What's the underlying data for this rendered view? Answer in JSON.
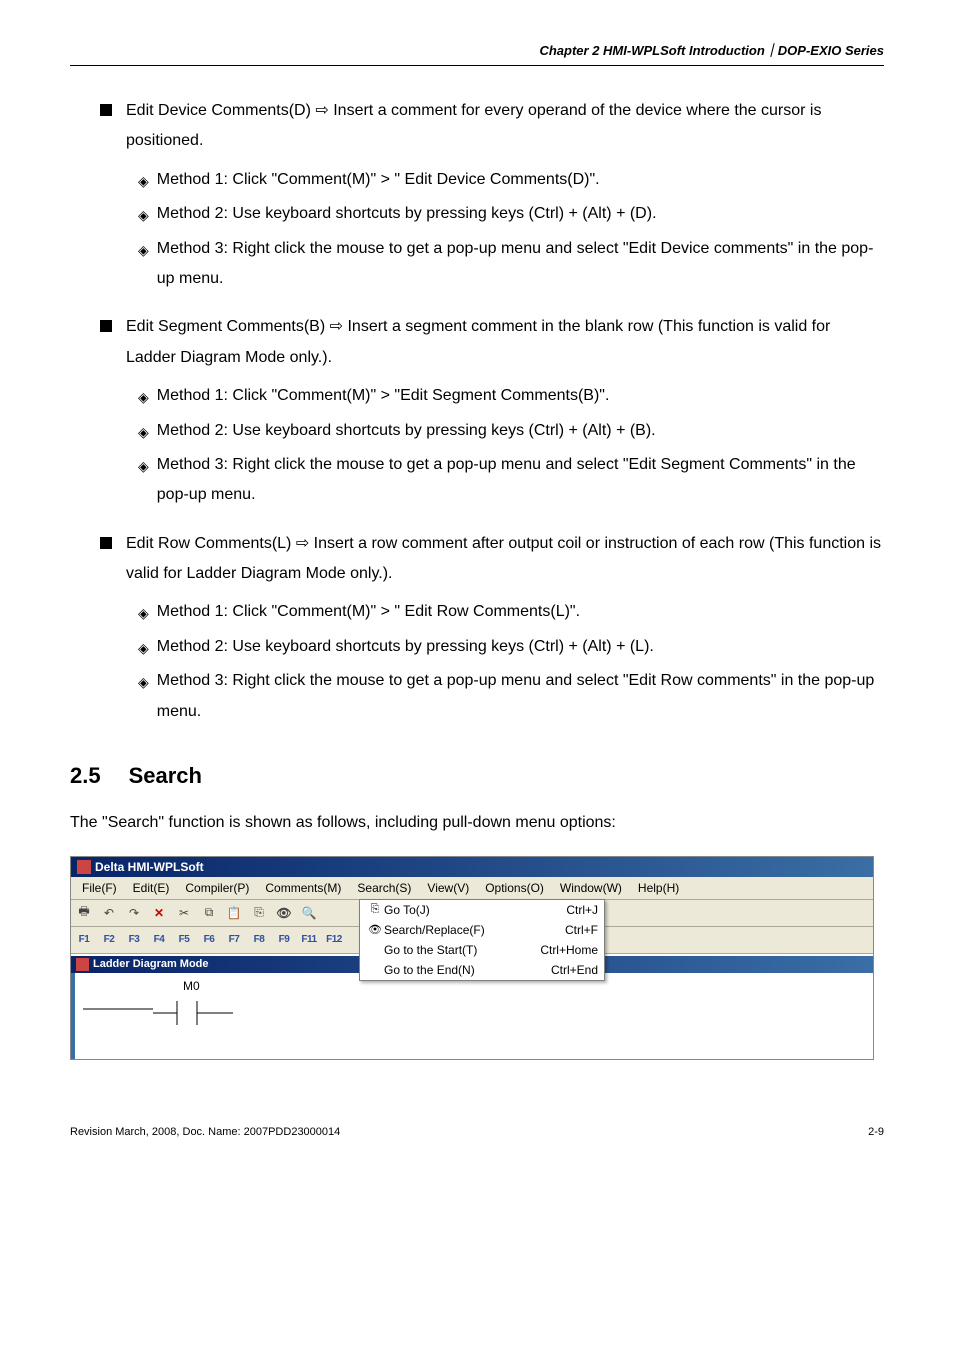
{
  "header": "Chapter 2 HMI-WPLSoft Introduction｜DOP-EXIO Series",
  "sections": [
    {
      "head": "Edit Device Comments(D) ⇨ Insert a comment for every operand of the device where the cursor is positioned.",
      "subs": [
        "Method 1: Click \"Comment(M)\" > \" Edit Device Comments(D)\".",
        "Method 2: Use keyboard shortcuts by pressing keys (Ctrl) + (Alt) + (D).",
        "Method 3: Right click the mouse to get a pop-up menu and select \"Edit Device comments\" in the pop-up menu."
      ]
    },
    {
      "head": "Edit Segment Comments(B) ⇨ Insert a segment comment in the blank row (This function is valid for Ladder Diagram Mode only.).",
      "subs": [
        "Method 1: Click \"Comment(M)\" > \"Edit Segment Comments(B)\".",
        "Method 2: Use keyboard shortcuts by pressing keys (Ctrl) + (Alt) + (B).",
        "Method 3: Right click the mouse to get a pop-up menu and select \"Edit Segment Comments\" in the pop-up menu."
      ]
    },
    {
      "head": "Edit Row Comments(L) ⇨ Insert a row comment after output coil or instruction of each row (This function is valid for Ladder Diagram Mode only.).",
      "subs": [
        "Method 1: Click \"Comment(M)\" > \" Edit Row Comments(L)\".",
        "Method 2: Use keyboard shortcuts by pressing keys (Ctrl) + (Alt) + (L).",
        "Method 3: Right click the mouse to get a pop-up menu and select \"Edit Row comments\" in the pop-up menu."
      ]
    }
  ],
  "heading": {
    "num": "2.5",
    "title": "Search"
  },
  "intro": "The \"Search\" function is shown as follows, including pull-down menu options:",
  "app": {
    "title": "Delta HMI-WPLSoft",
    "menu": [
      "File(F)",
      "Edit(E)",
      "Compiler(P)",
      "Comments(M)",
      "Search(S)",
      "View(V)",
      "Options(O)",
      "Window(W)",
      "Help(H)"
    ],
    "fkeys": [
      "F1",
      "F2",
      "F3",
      "F4",
      "F5",
      "F6",
      "F7",
      "F8",
      "F9",
      "F11",
      "F12"
    ],
    "dropdown": [
      {
        "icon": "goto-icon",
        "label": "Go To(J)",
        "shortcut": "Ctrl+J"
      },
      {
        "icon": "binoculars-icon",
        "label": "Search/Replace(F)",
        "shortcut": "Ctrl+F"
      },
      {
        "icon": "",
        "label": "Go to the Start(T)",
        "shortcut": "Ctrl+Home"
      },
      {
        "icon": "",
        "label": "Go to the End(N)",
        "shortcut": "Ctrl+End"
      }
    ],
    "child_title": "Ladder Diagram Mode",
    "ladder_label": "M0"
  },
  "footer": {
    "left": "Revision March, 2008, Doc. Name: 2007PDD23000014",
    "right": "2-9"
  }
}
